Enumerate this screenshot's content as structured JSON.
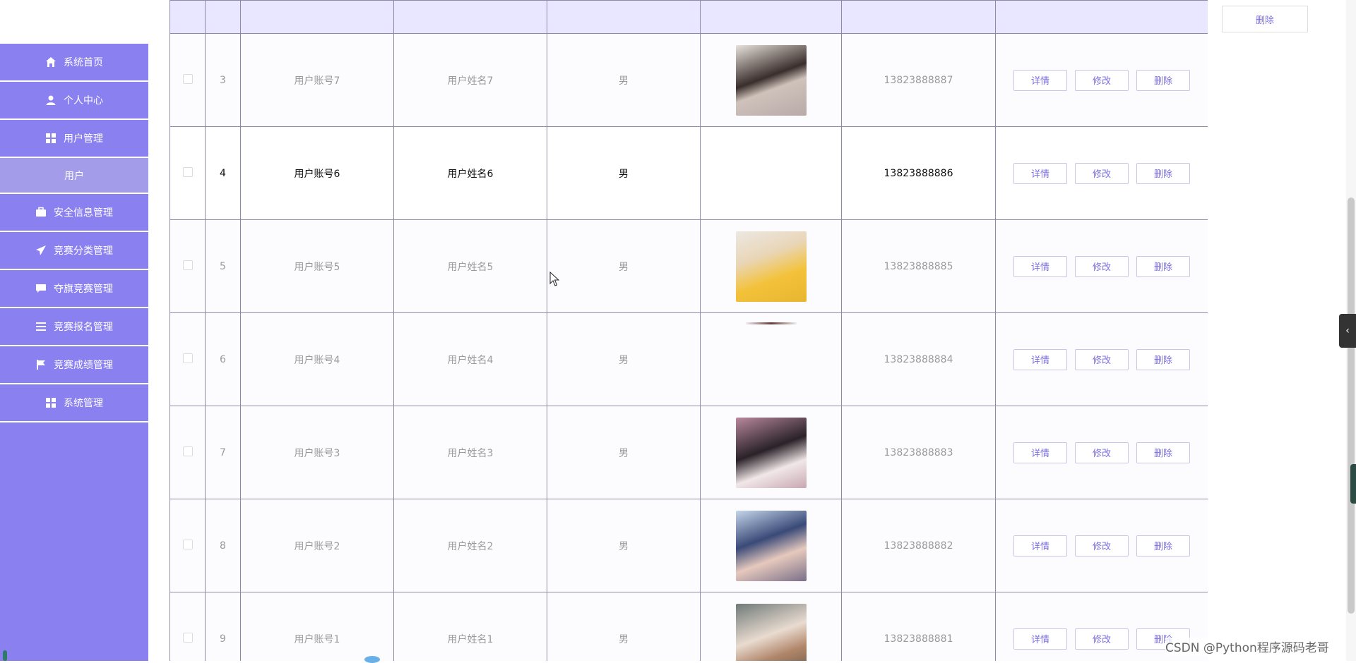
{
  "sidebar": {
    "items": [
      {
        "label": "系统首页",
        "icon": "home-icon"
      },
      {
        "label": "个人中心",
        "icon": "user-icon"
      },
      {
        "label": "用户管理",
        "icon": "grid-icon"
      },
      {
        "label": "用户",
        "icon": ""
      },
      {
        "label": "安全信息管理",
        "icon": "briefcase-icon"
      },
      {
        "label": "竞赛分类管理",
        "icon": "send-icon"
      },
      {
        "label": "夺旗竞赛管理",
        "icon": "chat-icon"
      },
      {
        "label": "竞赛报名管理",
        "icon": "list-icon"
      },
      {
        "label": "竞赛成绩管理",
        "icon": "flag-icon"
      },
      {
        "label": "系统管理",
        "icon": "grid-icon"
      }
    ]
  },
  "top": {
    "delete_label": "删除"
  },
  "table": {
    "rows": [
      {
        "index": "3",
        "account": "用户账号7",
        "name": "用户姓名7",
        "gender": "男",
        "phone": "13823888887",
        "avatar": "photo-girl-long-hair"
      },
      {
        "index": "4",
        "account": "用户账号6",
        "name": "用户姓名6",
        "gender": "男",
        "phone": "13823888886",
        "avatar": ""
      },
      {
        "index": "5",
        "account": "用户账号5",
        "name": "用户姓名5",
        "gender": "男",
        "phone": "13823888885",
        "avatar": "photo-boy-yellow-shirt"
      },
      {
        "index": "6",
        "account": "用户账号4",
        "name": "用户姓名4",
        "gender": "男",
        "phone": "13823888884",
        "avatar": "partial-image"
      },
      {
        "index": "7",
        "account": "用户账号3",
        "name": "用户姓名3",
        "gender": "男",
        "phone": "13823888883",
        "avatar": "photo-girl-selfie"
      },
      {
        "index": "8",
        "account": "用户账号2",
        "name": "用户姓名2",
        "gender": "男",
        "phone": "13823888882",
        "avatar": "photo-girl-cap"
      },
      {
        "index": "9",
        "account": "用户账号1",
        "name": "用户姓名1",
        "gender": "男",
        "phone": "13823888881",
        "avatar": "photo-girl-outdoor"
      }
    ],
    "actions": {
      "detail": "详情",
      "edit": "修改",
      "delete": "删除"
    }
  },
  "watermark": "CSDN @Python程序源码老哥",
  "colors": {
    "sidebar": "#8a80f0",
    "header": "#e9e6ff",
    "button_text": "#7b70e0"
  }
}
